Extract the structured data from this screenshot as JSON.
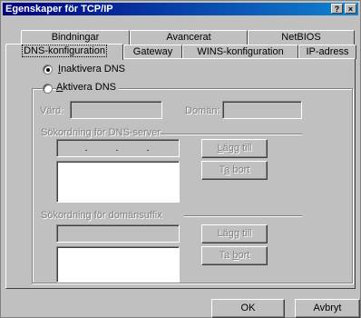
{
  "window": {
    "title": "Egenskaper för TCP/IP"
  },
  "titlebar_buttons": {
    "help": "?",
    "close": "×"
  },
  "tabs_row_back": [
    {
      "label": "Bindningar"
    },
    {
      "label": "Avancerat"
    },
    {
      "label": "NetBIOS"
    }
  ],
  "tabs_row_front": [
    {
      "label": "DNS-konfiguration",
      "selected": true
    },
    {
      "label": "Gateway"
    },
    {
      "label": "WINS-konfiguration"
    },
    {
      "label": "IP-adress"
    }
  ],
  "dns": {
    "radio_disable": {
      "label": "Inaktivera DNS",
      "checked": true
    },
    "radio_enable": {
      "label": "Aktivera DNS",
      "checked": false
    },
    "host_label": "Värd:",
    "host_value": "",
    "domain_label": "Domän:",
    "domain_value": "",
    "server_order_label": "Sökordning för DNS-server",
    "ip_value": [
      "",
      "",
      "",
      ""
    ],
    "server_list": [],
    "add_button_1": "Lägg till",
    "remove_button_1": "Ta bort",
    "suffix_order_label": "Sökordning för domänsuffix",
    "suffix_value": "",
    "suffix_list": [],
    "add_button_2": "Lägg till",
    "remove_button_2": "Ta bort"
  },
  "footer": {
    "ok": "OK",
    "cancel": "Avbryt"
  },
  "colors": {
    "face": "#c0c0c0",
    "title_start": "#000080",
    "title_end": "#1084d0"
  }
}
